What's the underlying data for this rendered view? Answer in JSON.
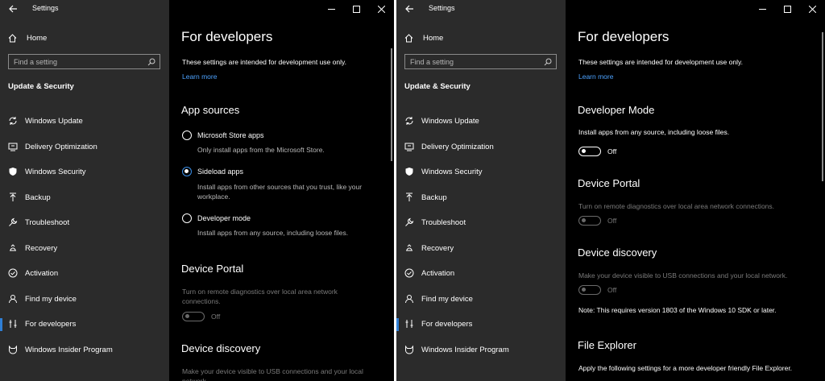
{
  "app": {
    "title": "Settings"
  },
  "sidebar": {
    "home_label": "Home",
    "search_placeholder": "Find a setting",
    "section_title": "Update & Security",
    "items": [
      {
        "label": "Windows Update",
        "icon": "sync-icon"
      },
      {
        "label": "Delivery Optimization",
        "icon": "delivery-optimization-icon"
      },
      {
        "label": "Windows Security",
        "icon": "shield-icon"
      },
      {
        "label": "Backup",
        "icon": "backup-arrow-icon"
      },
      {
        "label": "Troubleshoot",
        "icon": "wrench-icon"
      },
      {
        "label": "Recovery",
        "icon": "recovery-icon"
      },
      {
        "label": "Activation",
        "icon": "check-circle-icon"
      },
      {
        "label": "Find my device",
        "icon": "person-location-icon"
      },
      {
        "label": "For developers",
        "icon": "developer-tools-icon",
        "active": true
      },
      {
        "label": "Windows Insider Program",
        "icon": "cat-icon"
      }
    ]
  },
  "left": {
    "page_title": "For developers",
    "intro": "These settings are intended for development use only.",
    "learn_more": "Learn more",
    "app_sources": {
      "title": "App sources",
      "options": [
        {
          "label": "Microsoft Store apps",
          "desc": "Only install apps from the Microsoft Store.",
          "checked": false
        },
        {
          "label": "Sideload apps",
          "desc": "Install apps from other sources that you trust, like your workplace.",
          "checked": true
        },
        {
          "label": "Developer mode",
          "desc": "Install apps from any source, including loose files.",
          "checked": false
        }
      ]
    },
    "device_portal": {
      "title": "Device Portal",
      "desc": "Turn on remote diagnostics over local area network connections.",
      "toggle_state": "Off"
    },
    "device_discovery": {
      "title": "Device discovery",
      "desc": "Make your device visible to USB connections and your local network."
    }
  },
  "right": {
    "page_title": "For developers",
    "intro": "These settings are intended for development use only.",
    "learn_more": "Learn more",
    "developer_mode": {
      "title": "Developer Mode",
      "desc": "Install apps from any source, including loose files.",
      "toggle_state": "Off"
    },
    "device_portal": {
      "title": "Device Portal",
      "desc": "Turn on remote diagnostics over local area network connections.",
      "toggle_state": "Off"
    },
    "device_discovery": {
      "title": "Device discovery",
      "desc": "Make your device visible to USB connections and your local network.",
      "toggle_state": "Off",
      "note": "Note: This requires version 1803 of the Windows 10 SDK or later."
    },
    "file_explorer": {
      "title": "File Explorer",
      "desc": "Apply the following settings for a more developer friendly File Explorer."
    }
  },
  "colors": {
    "accent": "#2f7fd6",
    "link": "#4da3ff",
    "sidebar_bg": "#2b2b2b",
    "content_bg": "#000000"
  }
}
